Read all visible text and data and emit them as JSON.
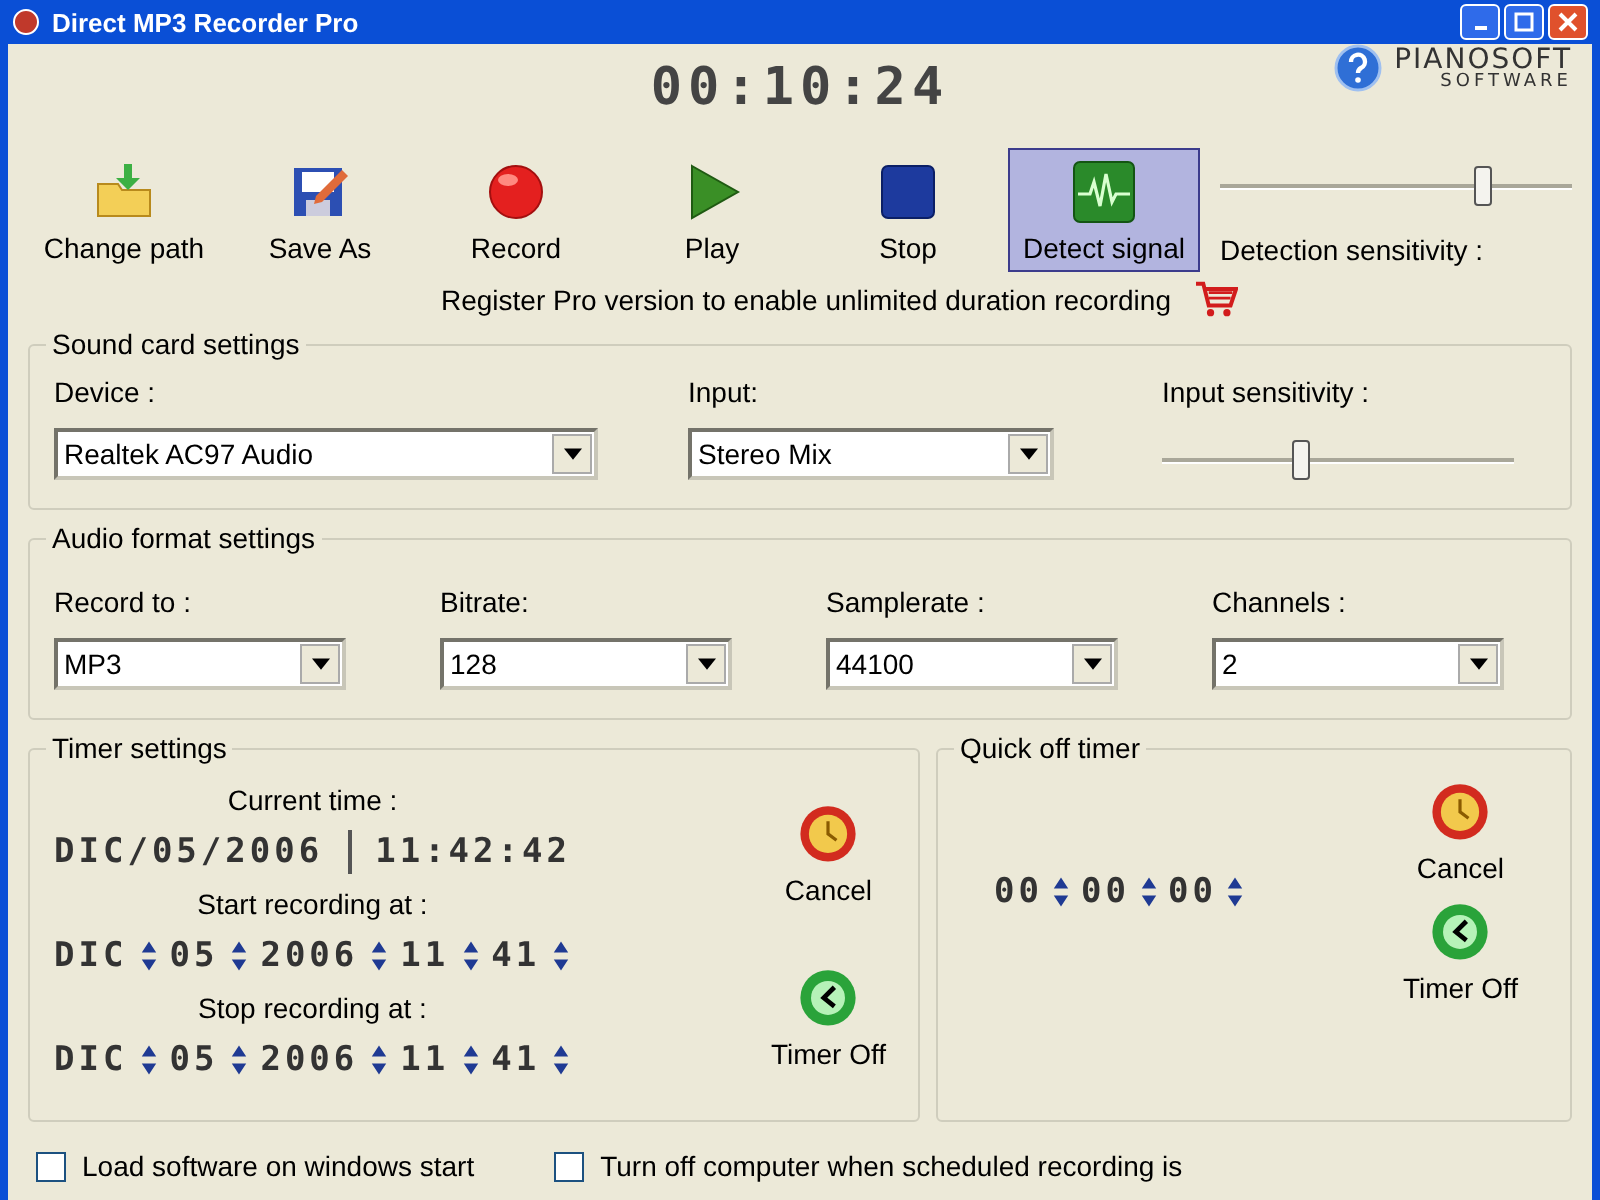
{
  "window": {
    "title": "Direct MP3 Recorder Pro"
  },
  "clock": "00:10:24",
  "logo": {
    "name": "PIANOSOFT",
    "tagline": "SOFTWARE"
  },
  "toolbar": [
    {
      "label": "Change path",
      "selected": false
    },
    {
      "label": "Save As",
      "selected": false
    },
    {
      "label": "Record",
      "selected": false
    },
    {
      "label": "Play",
      "selected": false
    },
    {
      "label": "Stop",
      "selected": false
    },
    {
      "label": "Detect signal",
      "selected": true
    }
  ],
  "detection_sensitivity": {
    "label": "Detection sensitivity :",
    "level": 0.75
  },
  "register_notice": "Register Pro version to enable unlimited duration recording",
  "sound_card": {
    "title": "Sound card settings",
    "device": {
      "label": "Device :",
      "value": "Realtek AC97 Audio"
    },
    "input": {
      "label": "Input:",
      "value": "Stereo Mix"
    },
    "input_sensitivity": {
      "label": "Input sensitivity :",
      "level": 0.4
    }
  },
  "audio_format": {
    "title": "Audio format settings",
    "fields": [
      {
        "label": "Record to :",
        "value": "MP3"
      },
      {
        "label": "Bitrate:",
        "value": "128"
      },
      {
        "label": "Samplerate :",
        "value": "44100"
      },
      {
        "label": "Channels :",
        "value": "2"
      }
    ]
  },
  "timer": {
    "title": "Timer settings",
    "current_time_label": "Current time :",
    "current_date": "DIC/05/2006",
    "current_time": "11:42:42",
    "start_label": "Start recording at :",
    "start": [
      "DIC",
      "05",
      "2006",
      "11",
      "41"
    ],
    "stop_label": "Stop recording at :",
    "stop": [
      "DIC",
      "05",
      "2006",
      "11",
      "41"
    ],
    "cancel": "Cancel",
    "timer_off": "Timer Off"
  },
  "quick_off": {
    "title": "Quick off timer",
    "values": [
      "00",
      "00",
      "00"
    ],
    "cancel": "Cancel",
    "timer_off": "Timer Off"
  },
  "options": [
    {
      "label": "Load software on windows start",
      "checked": false
    },
    {
      "label": "Turn off computer when scheduled recording is",
      "checked": false
    }
  ]
}
